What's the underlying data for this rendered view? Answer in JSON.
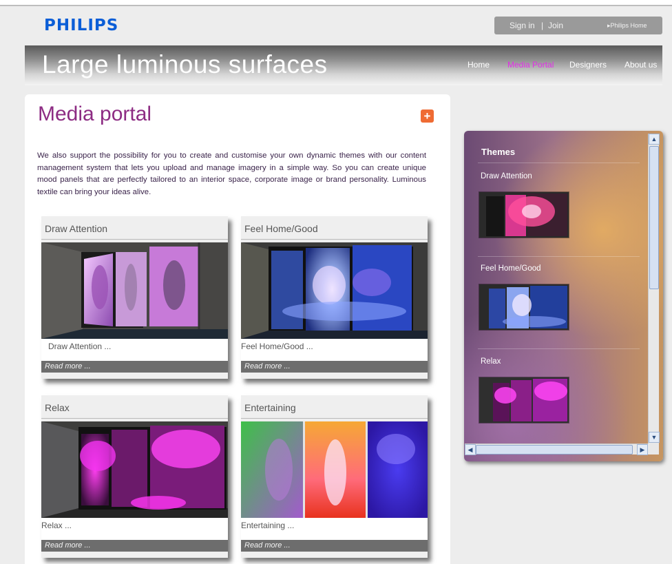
{
  "brand": "PHILIPS",
  "header": {
    "sign_in": "Sign in",
    "separator": "|",
    "join": "Join",
    "philips_home": "▸Philips Home"
  },
  "banner": {
    "title": "Large luminous surfaces"
  },
  "nav": [
    {
      "label": "Home",
      "active": false
    },
    {
      "label": "Media Portal",
      "active": true
    },
    {
      "label": "Designers",
      "active": false
    },
    {
      "label": "About us",
      "active": false
    }
  ],
  "main": {
    "title": "Media portal",
    "intro": "We also support the possibility for you to create and customise your own dynamic themes with our content management system that lets you upload and manage imagery in a simple way. So you can create unique mood panels that are perfectly tailored to an interior space, corporate image or brand personality. Luminous textile can bring your ideas alive.",
    "cards": [
      {
        "title": "Draw Attention",
        "desc": "Draw Attention ...",
        "read_more": "Read more ..."
      },
      {
        "title": "Feel Home/Good",
        "desc": "Feel Home/Good ...",
        "read_more": "Read more ..."
      },
      {
        "title": "Relax",
        "desc": "Relax ...",
        "read_more": "Read more ..."
      },
      {
        "title": "Entertaining",
        "desc": "Entertaining ...",
        "read_more": "Read more ..."
      }
    ]
  },
  "sidebar": {
    "title": "Themes",
    "items": [
      {
        "label": "Draw Attention"
      },
      {
        "label": "Feel Home/Good"
      },
      {
        "label": "Relax"
      }
    ]
  },
  "colors": {
    "brand_blue": "#0b5ed7",
    "accent_magenta": "#e12fe6",
    "title_purple": "#8d2c83",
    "add_orange": "#ef6b33"
  }
}
